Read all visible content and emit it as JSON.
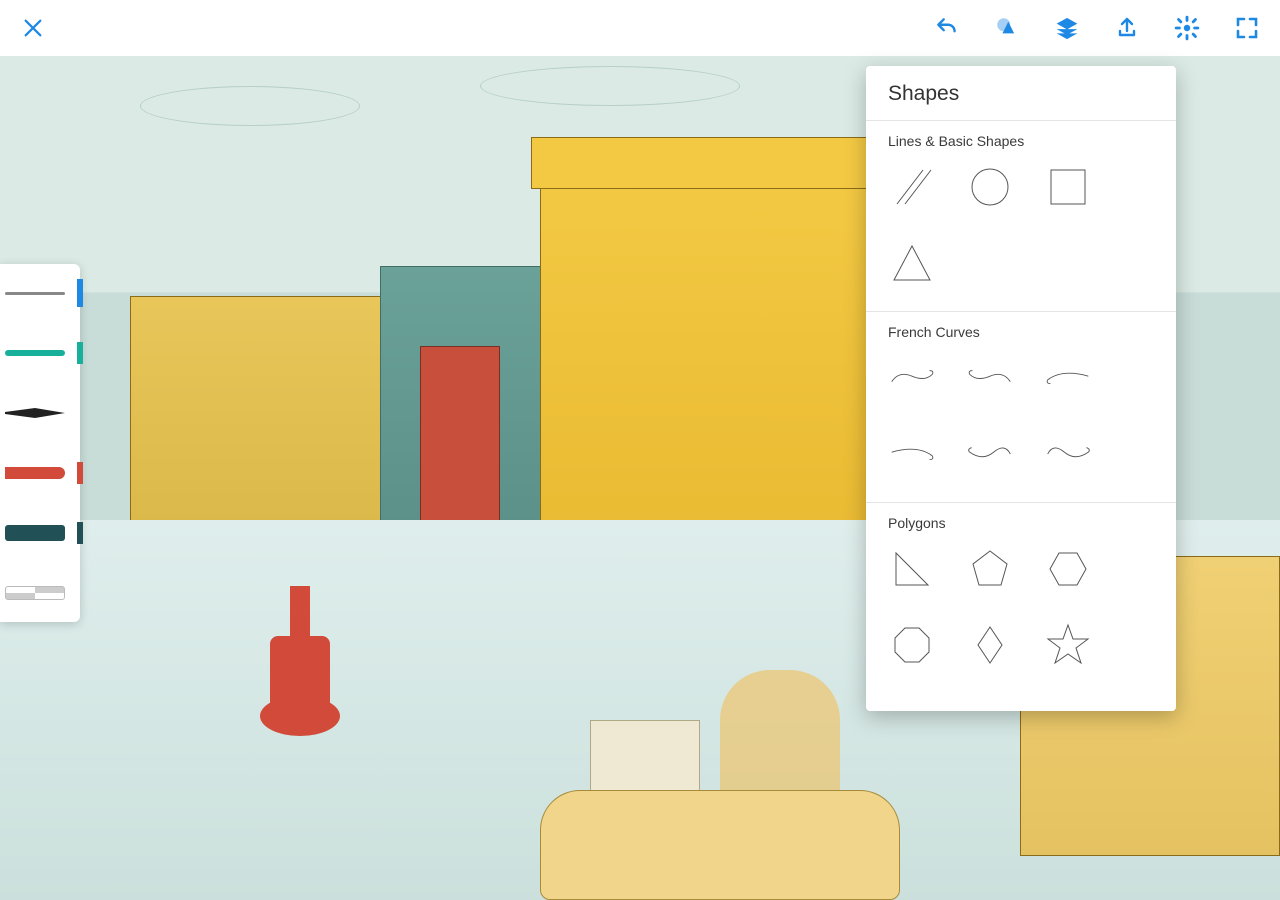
{
  "toolbar": {
    "close": "close",
    "undo": "undo",
    "shapes_tool": "shapes",
    "layers": "layers",
    "share": "share",
    "settings": "settings",
    "fullscreen": "fullscreen"
  },
  "brushes": [
    {
      "id": "pencil",
      "color": "#1e88e5",
      "selected": true
    },
    {
      "id": "fine-marker",
      "color": "#18b09b"
    },
    {
      "id": "ink-pen",
      "color": "#000000"
    },
    {
      "id": "chisel-marker",
      "color": "#d14a3a"
    },
    {
      "id": "watercolor",
      "color": "#225057"
    },
    {
      "id": "eraser",
      "color": "#ffffff"
    }
  ],
  "popover": {
    "title": "Shapes",
    "sections": [
      {
        "title": "Lines & Basic Shapes",
        "items": [
          "parallel-lines",
          "circle",
          "square",
          "triangle"
        ]
      },
      {
        "title": "French Curves",
        "items": [
          "french-curve-1",
          "french-curve-2",
          "french-curve-3",
          "french-curve-4",
          "french-curve-5",
          "french-curve-6"
        ]
      },
      {
        "title": "Polygons",
        "items": [
          "right-triangle",
          "pentagon",
          "hexagon",
          "octagon",
          "rhombus",
          "star"
        ]
      }
    ]
  }
}
